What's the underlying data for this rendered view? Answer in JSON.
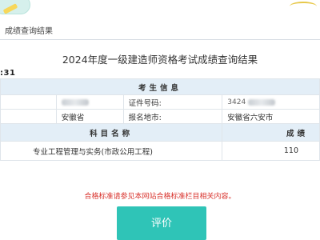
{
  "breadcrumb": "成绩查询结果",
  "page_title": "2024年度一级建造师资格考试成绩查询结果",
  "exam_id": ":31",
  "info_section": {
    "title": "考生信息",
    "id_label": "证件号码:",
    "id_value_partial": "3424",
    "province": "安徽省",
    "region_label": "报名地市:",
    "region_value": "安徽省六安市"
  },
  "score_section": {
    "subject_header": "科目名称",
    "score_header": "成绩",
    "rows": [
      {
        "subject": "专业工程管理与实务(市政公用工程)",
        "score": "110"
      }
    ]
  },
  "notice": "合格标准请参见本网站合格标准栏目相关内容。",
  "eval_button_label": "评价",
  "colors": {
    "accent": "#2fc4b7",
    "header_bg": "#e3eef7",
    "notice": "#d9352f"
  }
}
